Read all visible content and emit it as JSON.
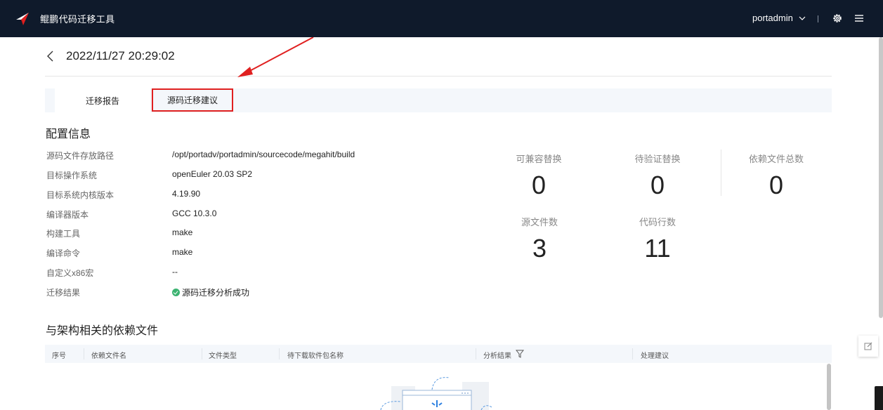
{
  "app": {
    "title": "鲲鹏代码迁移工具",
    "user": "portadmin",
    "icons": [
      "kunpeng-logo-icon",
      "chevron-down-icon",
      "gear-icon",
      "menu-icon"
    ]
  },
  "header": {
    "title": "2022/11/27 20:29:02"
  },
  "tabs": [
    {
      "label": "迁移报告",
      "active": true
    },
    {
      "label": "源码迁移建议",
      "active": false,
      "highlighted": true
    }
  ],
  "config": {
    "title": "配置信息",
    "rows": [
      {
        "label": "源码文件存放路径",
        "value": "/opt/portadv/portadmin/sourcecode/megahit/build"
      },
      {
        "label": "目标操作系统",
        "value": "openEuler 20.03 SP2"
      },
      {
        "label": "目标系统内核版本",
        "value": "4.19.90"
      },
      {
        "label": "编译器版本",
        "value": "GCC 10.3.0"
      },
      {
        "label": "构建工具",
        "value": "make"
      },
      {
        "label": "编译命令",
        "value": "make"
      },
      {
        "label": "自定义x86宏",
        "value": "--"
      },
      {
        "label": "迁移结果",
        "value": "源码迁移分析成功",
        "status": "success"
      }
    ]
  },
  "stats": [
    {
      "label": "可兼容替换",
      "value": "0"
    },
    {
      "label": "待验证替换",
      "value": "0"
    },
    {
      "label": "依赖文件总数",
      "value": "0"
    },
    {
      "label": "源文件数",
      "value": "3"
    },
    {
      "label": "代码行数",
      "value": "11"
    }
  ],
  "deps": {
    "title": "与架构相关的依赖文件",
    "columns": [
      "序号",
      "依赖文件名",
      "文件类型",
      "待下载软件包名称",
      "分析结果",
      "处理建议"
    ]
  },
  "colors": {
    "topbar": "#0f1a2b",
    "highlight": "#e02020",
    "success": "#3cb371",
    "tab_bg": "#f4f7fb"
  }
}
